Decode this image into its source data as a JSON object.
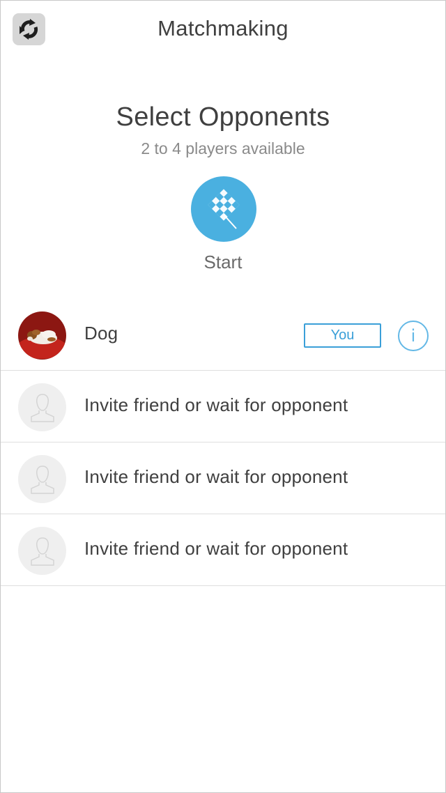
{
  "header": {
    "title": "Matchmaking",
    "app_icon": "game-logo-icon"
  },
  "selection": {
    "headline": "Select Opponents",
    "subline": "2 to 4 players available",
    "start_label": "Start",
    "start_icon": "checkered-flag-icon",
    "accent_color": "#4ab0e0"
  },
  "players": {
    "current": {
      "name": "Dog",
      "badge": "You",
      "info_glyph": "i",
      "avatar": "dog-photo"
    },
    "slots": [
      {
        "label": "Invite friend or wait for opponent",
        "avatar": "person-placeholder-icon"
      },
      {
        "label": "Invite friend or wait for opponent",
        "avatar": "person-placeholder-icon"
      },
      {
        "label": "Invite friend or wait for opponent",
        "avatar": "person-placeholder-icon"
      }
    ]
  }
}
